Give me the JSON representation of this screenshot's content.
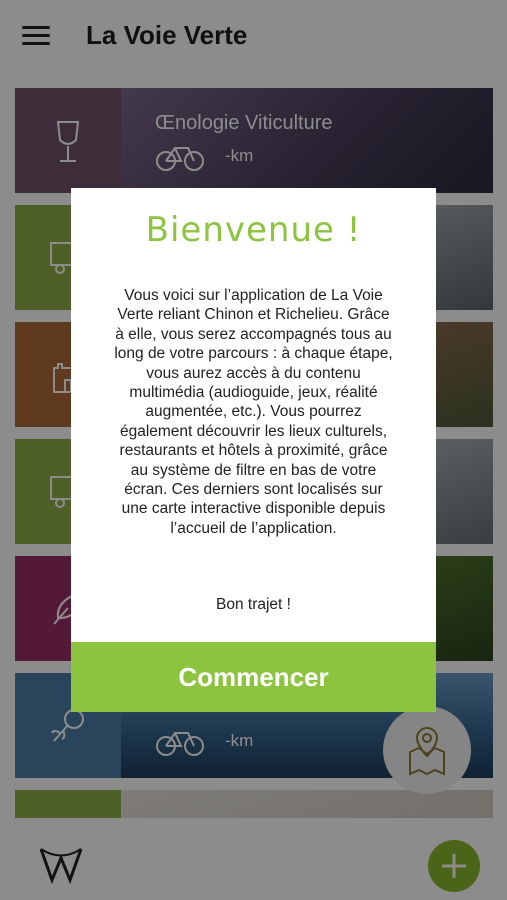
{
  "header": {
    "title": "La Voie Verte"
  },
  "routes": [
    {
      "name": "Œnologie Viticulture",
      "distance": "-km",
      "icon": "wine-glass-icon"
    },
    {
      "name": "",
      "distance": "",
      "icon": "caravan-icon"
    },
    {
      "name": "",
      "distance": "",
      "icon": "castle-icon"
    },
    {
      "name": "",
      "distance": "",
      "icon": "caravan-icon"
    },
    {
      "name": "",
      "distance": "",
      "icon": "feather-icon"
    },
    {
      "name": "",
      "distance": "-km",
      "icon": "rose-icon"
    },
    {
      "name": "",
      "distance": "",
      "icon": ""
    }
  ],
  "modal": {
    "title": "Bienvenue !",
    "body": "Vous voici sur l’application de La Voie Verte reliant Chinon et Richelieu. Grâce à elle, vous serez accompagnés tous au long de votre parcours : à chaque étape, vous aurez accès à du contenu multimédia (audioguide, jeux, réalité augmentée, etc.). Vous pourrez également découvrir les lieux culturels, restaurants et hôtels à proximité, grâce au système de filtre en bas de votre écran. Ces derniers sont localisés sur une carte interactive disponible depuis l’accueil de l’application.",
    "greeting": "Bon trajet !",
    "button": "Commencer"
  },
  "colors": {
    "accent": "#8cc43f",
    "button_green": "#88b62c"
  }
}
